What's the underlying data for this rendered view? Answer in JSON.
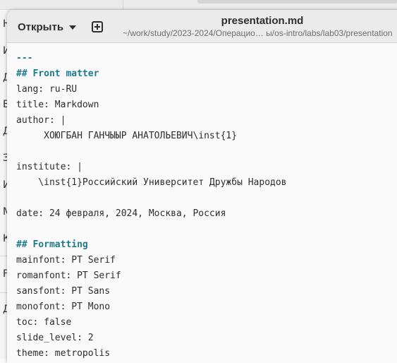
{
  "background_window": {
    "sidebar_letters": [
      "Н",
      "И",
      "Д",
      "В",
      "Д",
      "З",
      "И",
      "М",
      "К",
      "F",
      "Д"
    ]
  },
  "editor": {
    "open_button_label": "Открыть",
    "title": "presentation.md",
    "path": "~/work/study/2023-2024/Операцио… ы/os-intro/labs/lab03/presentation",
    "lines": [
      "---",
      "## Front matter",
      "lang: ru-RU",
      "title: Markdown",
      "author: |",
      "     ХОЮГБАН ГАНЧЫЫР АНАТОЛЬЕВИЧ\\inst{1}",
      "",
      "institute: |",
      "    \\inst{1}Российский Университет Дружбы Народов",
      "",
      "date: 24 февраля, 2024, Москва, Россия",
      "",
      "## Formatting",
      "mainfont: PT Serif",
      "romanfont: PT Serif",
      "sansfont: PT Sans",
      "monofont: PT Mono",
      "toc: false",
      "slide_level: 2",
      "theme: metropolis"
    ]
  },
  "colors": {
    "heading": "#1f7a8c",
    "text": "#2e2e2e",
    "background": "#fafafa",
    "header": "#ebebeb"
  }
}
